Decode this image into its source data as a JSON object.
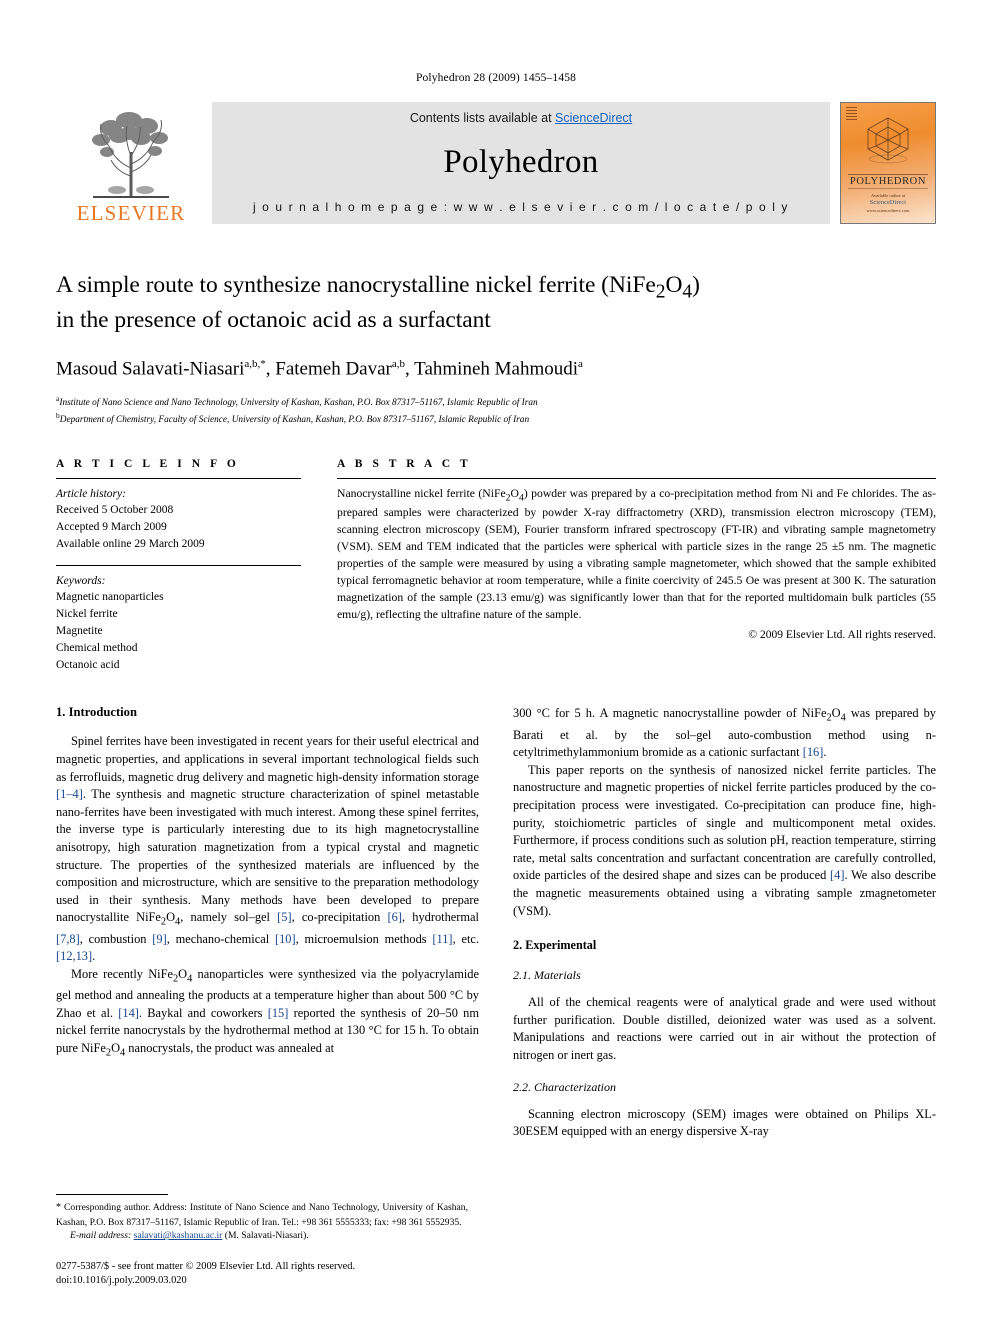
{
  "running_head": "Polyhedron 28 (2009) 1455–1458",
  "masthead": {
    "publisher_name": "ELSEVIER",
    "contents_prefix": "Contents lists available at ",
    "sciencedirect": "ScienceDirect",
    "journal_name": "Polyhedron",
    "homepage": "j o u r n a l   h o m e p a g e :   w w w . e l s e v i e r . c o m / l o c a t e / p o l y",
    "cover_title": "POLYHEDRON",
    "cover_footer_line1": "Available online at",
    "cover_footer_line2": "ScienceDirect",
    "cover_footer_line3": "www.sciencedirect.com"
  },
  "article": {
    "title_line1": "A simple route to synthesize nanocrystalline nickel ferrite (NiFe",
    "title_sub1": "2",
    "title_mid": "O",
    "title_sub2": "4",
    "title_end": ")",
    "title_line2": "in the presence of octanoic acid as a surfactant",
    "authors": [
      {
        "name": "Masoud Salavati-Niasari",
        "sup": "a,b,*"
      },
      {
        "name": "Fatemeh Davar",
        "sup": "a,b"
      },
      {
        "name": "Tahmineh Mahmoudi",
        "sup": "a"
      }
    ],
    "affiliations": [
      {
        "marker": "a",
        "text": "Institute of Nano Science and Nano Technology, University of Kashan, Kashan, P.O. Box 87317–51167, Islamic Republic of Iran"
      },
      {
        "marker": "b",
        "text": "Department of Chemistry, Faculty of Science, University of Kashan, Kashan, P.O. Box 87317–51167, Islamic Republic of Iran"
      }
    ]
  },
  "article_info": {
    "heading": "A R T I C L E    I N F O",
    "history_label": "Article history:",
    "history": [
      "Received 5 October 2008",
      "Accepted 9 March 2009",
      "Available online 29 March 2009"
    ],
    "keywords_label": "Keywords:",
    "keywords": [
      "Magnetic nanoparticles",
      "Nickel ferrite",
      "Magnetite",
      "Chemical method",
      "Octanoic acid"
    ]
  },
  "abstract": {
    "heading": "A B S T R A C T",
    "text": "Nanocrystalline nickel ferrite (NiFe2O4) powder was prepared by a co-precipitation method from Ni and Fe chlorides. The as-prepared samples were characterized by powder X-ray diffractometry (XRD), transmission electron microscopy (TEM), scanning electron microscopy (SEM), Fourier transform infrared spectroscopy (FT-IR) and vibrating sample magnetometry (VSM). SEM and TEM indicated that the particles were spherical with particle sizes in the range 25 ±5 nm. The magnetic properties of the sample were measured by using a vibrating sample magnetometer, which showed that the sample exhibited typical ferromagnetic behavior at room temperature, while a finite coercivity of 245.5 Oe was present at 300 K. The saturation magnetization of the sample (23.13 emu/g) was significantly lower than that for the reported multidomain bulk particles (55 emu/g), reflecting the ultrafine nature of the sample.",
    "copyright": "© 2009 Elsevier Ltd. All rights reserved."
  },
  "sections": {
    "introduction_heading": "1. Introduction",
    "intro_p1": "Spinel ferrites have been investigated in recent years for their useful electrical and magnetic properties, and applications in several important technological fields such as ferrofluids, magnetic drug delivery and magnetic high-density information storage [1–4]. The synthesis and magnetic structure characterization of spinel metastable nano-ferrites have been investigated with much interest. Among these spinel ferrites, the inverse type is particularly interesting due to its high magnetocrystalline anisotropy, high saturation magnetization from a typical crystal and magnetic structure. The properties of the synthesized materials are influenced by the composition and microstructure, which are sensitive to the preparation methodology used in their synthesis. Many methods have been developed to prepare nanocrystallite NiFe2O4, namely sol–gel [5], co-precipitation [6], hydrothermal [7,8], combustion [9], mechano-chemical [10], microemulsion methods [11], etc. [12,13].",
    "intro_p2": "More recently NiFe2O4 nanoparticles were synthesized via the polyacrylamide gel method and annealing the products at a temperature higher than about 500 °C by Zhao et al. [14]. Baykal and coworkers [15] reported the synthesis of 20–50 nm nickel ferrite nanocrystals by the hydrothermal method at 130 °C for 15 h. To obtain pure NiFe2O4 nanocrystals, the product was annealed at",
    "intro_p3": "300 °C for 5 h. A magnetic nanocrystalline powder of NiFe2O4 was prepared by Barati et al. by the sol–gel auto-combustion method using n-cetyltrimethylammonium bromide as a cationic surfactant [16].",
    "intro_p4": "This paper reports on the synthesis of nanosized nickel ferrite particles. The nanostructure and magnetic properties of nickel ferrite particles produced by the co-precipitation process were investigated. Co-precipitation can produce fine, high-purity, stoichiometric particles of single and multicomponent metal oxides. Furthermore, if process conditions such as solution pH, reaction temperature, stirring rate, metal salts concentration and surfactant concentration are carefully controlled, oxide particles of the desired shape and sizes can be produced [4]. We also describe the magnetic measurements obtained using a vibrating sample zmagnetometer (VSM).",
    "experimental_heading": "2. Experimental",
    "materials_heading": "2.1. Materials",
    "materials_p": "All of the chemical reagents were of analytical grade and were used without further purification. Double distilled, deionized water was used as a solvent. Manipulations and reactions were carried out in air without the protection of nitrogen or inert gas.",
    "characterization_heading": "2.2. Characterization",
    "characterization_p": "Scanning electron microscopy (SEM) images were obtained on Philips XL-30ESEM equipped with an energy dispersive X-ray"
  },
  "footnotes": {
    "corresponding": "Corresponding author. Address: Institute of Nano Science and Nano Technology, University of Kashan, Kashan, P.O. Box 87317–51167, Islamic Republic of Iran. Tel.: +98 361 5555333; fax: +98 361 5552935.",
    "email_label": "E-mail address:",
    "email": "salavati@kashanu.ac.ir",
    "email_attrib": "(M. Salavati-Niasari).",
    "issn_line": "0277-5387/$ - see front matter © 2009 Elsevier Ltd. All rights reserved.",
    "doi_line": "doi:10.1016/j.poly.2009.03.020"
  },
  "colors": {
    "elsevier_orange": "#E87722",
    "link_blue": "#17458f",
    "sciencedirect_blue": "#1565c0",
    "banner_gray": "#e3e3e3"
  }
}
